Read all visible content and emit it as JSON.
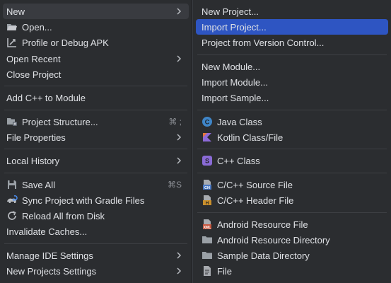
{
  "left_menu": {
    "new": "New",
    "open": "Open...",
    "profile_debug_apk": "Profile or Debug APK",
    "open_recent": "Open Recent",
    "close_project": "Close Project",
    "add_cpp_to_module": "Add C++ to Module",
    "project_structure": "Project Structure...",
    "project_structure_shortcut": "⌘ ;",
    "file_properties": "File Properties",
    "local_history": "Local History",
    "save_all": "Save All",
    "save_all_shortcut": "⌘S",
    "sync_gradle": "Sync Project with Gradle Files",
    "reload_from_disk": "Reload All from Disk",
    "invalidate_caches": "Invalidate Caches...",
    "manage_ide_settings": "Manage IDE Settings",
    "new_projects_settings": "New Projects Settings"
  },
  "right_menu": {
    "new_project": "New Project...",
    "import_project": "Import Project...",
    "project_from_vcs": "Project from Version Control...",
    "new_module": "New Module...",
    "import_module": "Import Module...",
    "import_sample": "Import Sample...",
    "java_class": "Java Class",
    "kotlin_class_file": "Kotlin Class/File",
    "cpp_class": "C++ Class",
    "cpp_source_file": "C/C++ Source File",
    "cpp_header_file": "C/C++ Header File",
    "android_resource_file": "Android Resource File",
    "android_resource_directory": "Android Resource Directory",
    "sample_data_directory": "Sample Data Directory",
    "file": "File"
  },
  "colors": {
    "menu_bg": "#2b2d30",
    "selected_bg": "#2e55c2",
    "hover_bg": "#393b40",
    "text": "#dfe1e5",
    "shortcut": "#8c8f95"
  }
}
